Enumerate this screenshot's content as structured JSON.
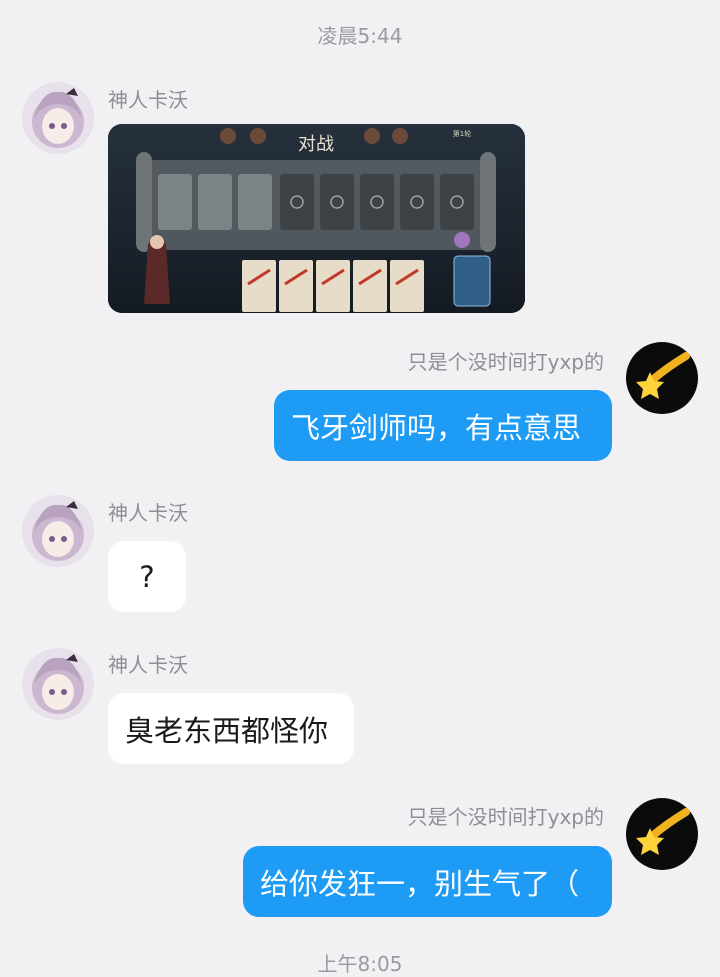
{
  "timestamps": [
    "凌晨5:44",
    "上午8:05"
  ],
  "messages": [
    {
      "sender": "神人卡沃",
      "direction": "incoming",
      "kind": "image",
      "image_title": "对战",
      "image_badge": "第1轮"
    },
    {
      "sender": "只是个没时间打yxp的",
      "direction": "outgoing",
      "kind": "text",
      "text": "飞牙剑师吗，有点意思"
    },
    {
      "sender": "神人卡沃",
      "direction": "incoming",
      "kind": "text",
      "text": "?"
    },
    {
      "sender": "神人卡沃",
      "direction": "incoming",
      "kind": "text",
      "text": "臭老东西都怪你"
    },
    {
      "sender": "只是个没时间打yxp的",
      "direction": "outgoing",
      "kind": "text",
      "text": "给你发狂一，别生气了（"
    }
  ],
  "colors": {
    "background": "#f1f1f4",
    "outgoing_bubble": "#1e9cf5",
    "incoming_bubble": "#ffffff",
    "meta_text": "#8e8e93"
  },
  "icons": {
    "incoming_avatar": "anime-girl-avatar",
    "outgoing_avatar": "shooting-star-avatar",
    "card_slot_lock": "lock-icon"
  }
}
